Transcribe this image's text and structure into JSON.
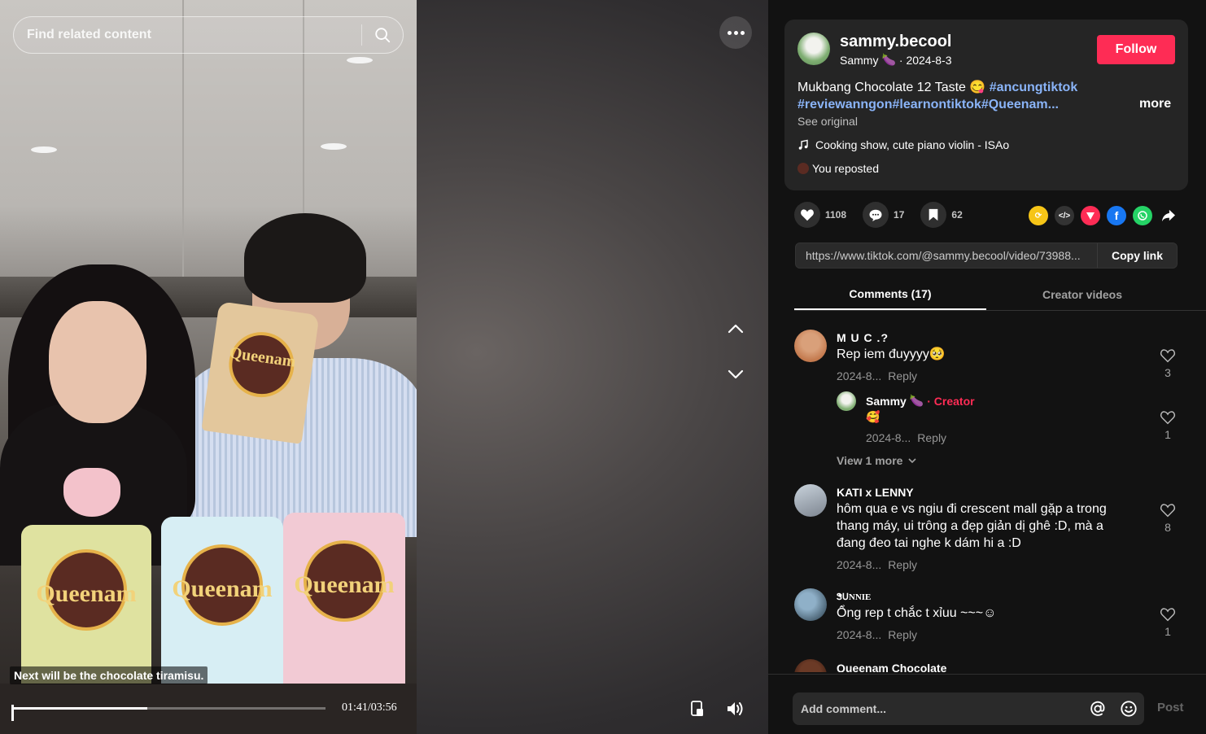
{
  "search": {
    "placeholder": "Find related content"
  },
  "video": {
    "caption_overlay": "Next will be the chocolate tiramisu.",
    "time": "01:41/03:56",
    "progress": 0.43,
    "brand_text": "Queenam"
  },
  "author": {
    "username": "sammy.becool",
    "nickname": "Sammy",
    "date": "· 2024-8-3",
    "follow_label": "Follow"
  },
  "post": {
    "title": "Mukbang Chocolate 12 Taste 😋 ",
    "hashtag_1": "#ancungtiktok",
    "hashtag_line_2": "#reviewanngon#learnontiktok#Queenam...",
    "more_label": "more",
    "see_original": "See original",
    "music": "Cooking show, cute piano violin - ISAo",
    "reposted": "You reposted"
  },
  "actions": {
    "likes": "1108",
    "comments": "17",
    "saves": "62"
  },
  "share_link": {
    "url": "https://www.tiktok.com/@sammy.becool/video/73988...",
    "copy_label": "Copy link"
  },
  "tabs": [
    {
      "label": "Comments (17)"
    },
    {
      "label": "Creator videos"
    }
  ],
  "comments": [
    {
      "name": "M U C .?",
      "text": "Rep iem đuyyyy🥺",
      "date": "2024-8...",
      "reply": "Reply",
      "likes": "3"
    },
    {
      "name": "Sammy",
      "creator_label": "· Creator",
      "text": "🥰",
      "date": "2024-8...",
      "reply": "Reply",
      "likes": "1"
    },
    {
      "name": "KATI x LENNY",
      "text_1": "hôm qua e vs ngiu đi crescent mall gặp a trong",
      "text_2": "thang máy, ui trông a đẹp giản dị ghê :D, mà a",
      "text_3": "đang đeo tai nghe k dám hi a :D",
      "date": "2024-8...",
      "reply": "Reply",
      "likes": "8"
    },
    {
      "name": "ᏕᑌNNIE",
      "text": "Ổng rep t chắc t xỉuu ~~~☺",
      "date": "2024-8...",
      "reply": "Reply",
      "likes": "1"
    },
    {
      "name": "Queenam Chocolate"
    }
  ],
  "view_more": "View 1 more",
  "bottom": {
    "placeholder": "Add comment...",
    "post_label": "Post"
  },
  "colors": {
    "accent": "#fe2c55",
    "hashtag": "#8ab4f8",
    "panel_bg": "#121212",
    "card_bg": "#252525"
  }
}
